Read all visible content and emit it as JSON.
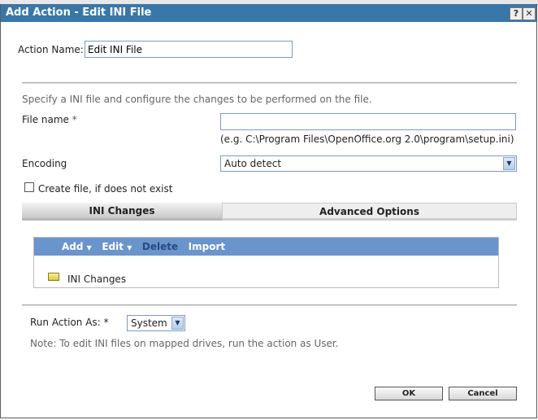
{
  "window": {
    "title": "Add Action - Edit INI File",
    "help": "?",
    "close": "✕"
  },
  "action_name": {
    "label": "Action Name:",
    "value": "Edit INI File"
  },
  "description": "Specify a INI file and configure the changes to be performed on the file.",
  "file_name": {
    "label": "File name",
    "required": "*",
    "value": "",
    "hint": "(e.g. C:\\Program Files\\OpenOffice.org 2.0\\program\\setup.ini)"
  },
  "encoding": {
    "label": "Encoding",
    "value": "Auto detect"
  },
  "create_file": {
    "label": "Create file, if does not exist",
    "checked": false
  },
  "tabs": [
    {
      "label": "INI Changes",
      "active": true
    },
    {
      "label": "Advanced Options",
      "active": false
    }
  ],
  "toolbar": {
    "add": "Add",
    "edit": "Edit",
    "delete": "Delete",
    "import": "Import"
  },
  "tree": {
    "root": "INI Changes"
  },
  "run_as": {
    "label": "Run Action As:",
    "required": "*",
    "value": "System"
  },
  "note": "Note: To edit INI files on mapped drives, run the action as User.",
  "buttons": {
    "ok": "OK",
    "cancel": "Cancel"
  }
}
